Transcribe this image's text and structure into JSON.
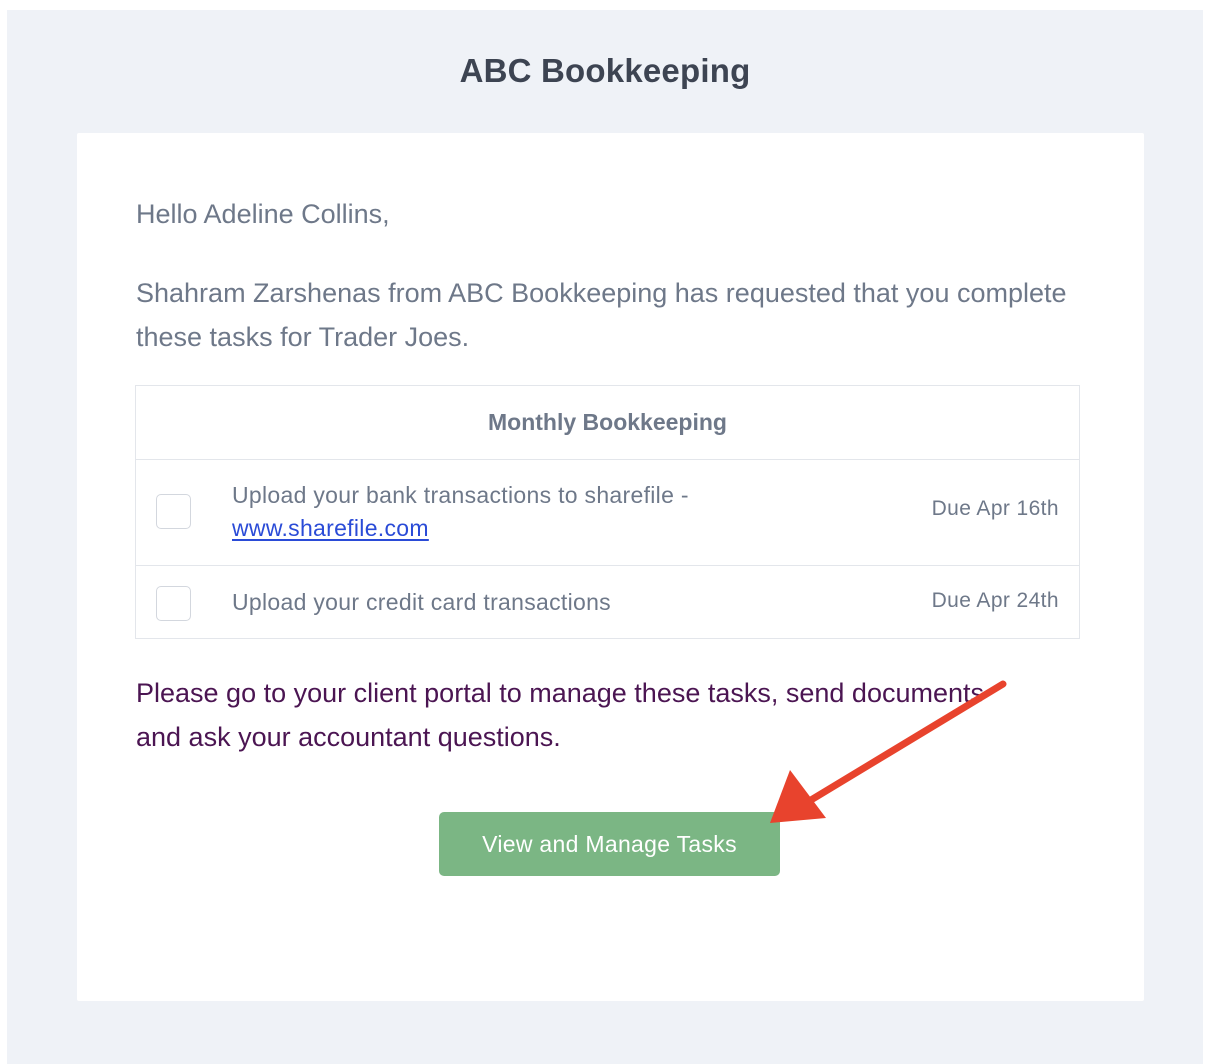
{
  "header": {
    "brand_title": "ABC Bookkeeping"
  },
  "message": {
    "greeting": "Hello Adeline Collins,",
    "intro": "Shahram Zarshenas from ABC Bookkeeping has requested that you complete these tasks for Trader Joes.",
    "portal_text": "Please go to your client portal to manage these tasks, send documents and ask your accountant questions."
  },
  "task_list": {
    "title": "Monthly Bookkeeping",
    "tasks": [
      {
        "text": "Upload your bank transactions to sharefile -",
        "link_text": "www.sharefile.com",
        "due": "Due Apr 16th",
        "checked": false
      },
      {
        "text": "Upload your credit card transactions",
        "due": "Due Apr 24th",
        "checked": false
      }
    ]
  },
  "cta": {
    "label": "View and Manage Tasks",
    "color": "#7bb684"
  },
  "colors": {
    "page_background": "#eff2f7",
    "card_background": "#ffffff",
    "body_text": "#6e7889",
    "portal_text": "#4b1552",
    "link": "#2a4bd7",
    "annotation_arrow": "#e8432d"
  }
}
